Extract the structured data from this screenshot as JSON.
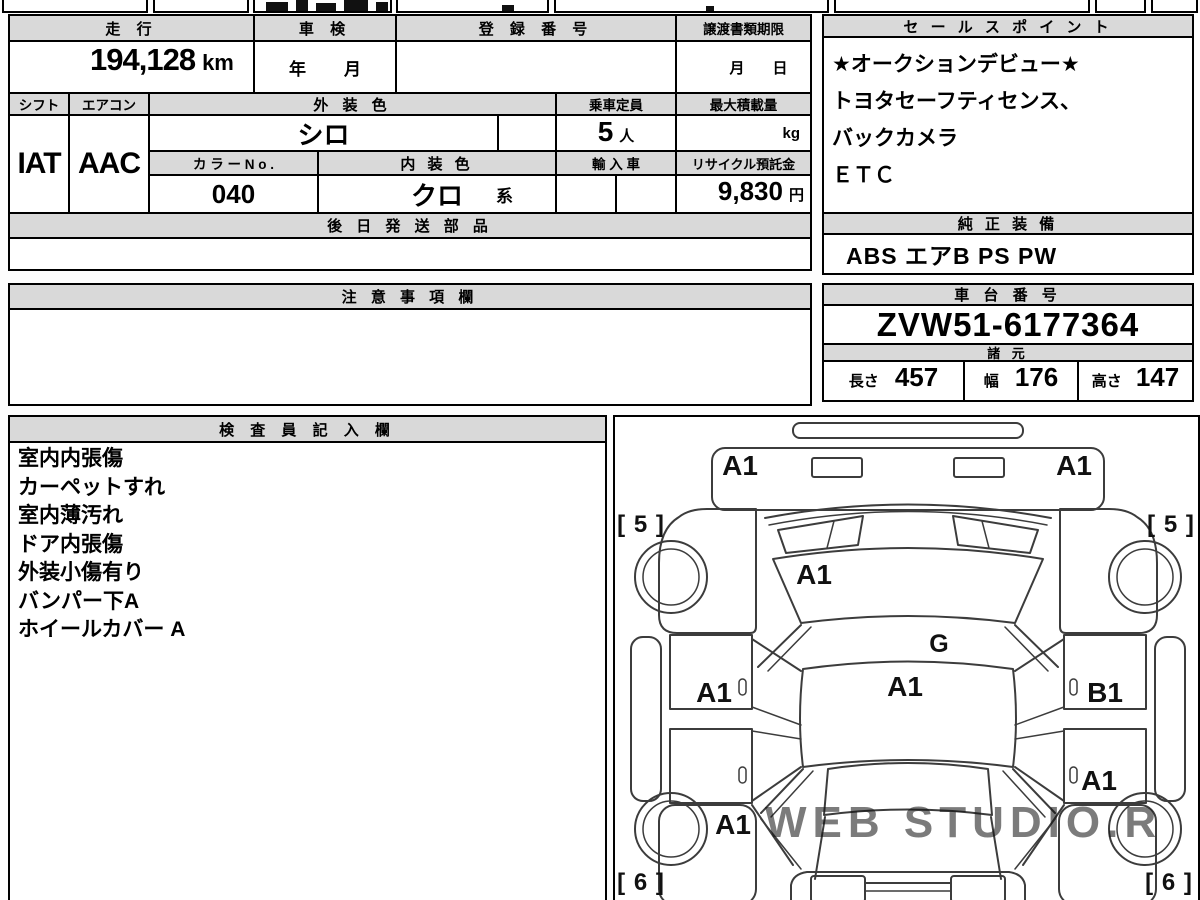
{
  "table": {
    "mileage_label": "走 行",
    "mileage_value": "194,128",
    "mileage_unit": "km",
    "shaken_label": "車 検",
    "shaken_year": "年",
    "shaken_month": "月",
    "registration_label": "登 録 番 号",
    "registration_value": "",
    "transfer_label": "譲渡書類期限",
    "transfer_month": "月",
    "transfer_day": "日",
    "shift_label": "シフト",
    "shift_value": "IAT",
    "aircon_label": "エアコン",
    "aircon_value": "AAC",
    "exterior_color_label": "外 装 色",
    "exterior_color_value": "シロ",
    "capacity_label": "乗車定員",
    "capacity_value": "5",
    "capacity_unit": "人",
    "max_load_label": "最大積載量",
    "max_load_unit": "kg",
    "color_no_label": "カ ラ ー N o .",
    "color_no_value": "040",
    "interior_color_label": "内 装 色",
    "interior_color_value": "クロ",
    "interior_color_suffix": "系",
    "import_label": "輸 入 車",
    "recycle_label": "リサイクル預託金",
    "recycle_value": "9,830",
    "recycle_unit": "円",
    "later_shipping_label": "後 日 発 送 部 品",
    "later_shipping_value": "",
    "notes_label": "注 意 事 項 欄",
    "notes_value": ""
  },
  "sales_points": {
    "title": "セ ー ル ス ポ イ ン ト",
    "lines": [
      "★オークションデビュー★",
      "トヨタセーフティセンス、",
      "バックカメラ",
      "ＥＴＣ"
    ]
  },
  "equipment": {
    "title": "純 正 装 備",
    "value": "ABS エアB PS PW"
  },
  "chassis": {
    "title": "車 台 番 号",
    "number": "ZVW51-6177364"
  },
  "specs": {
    "title": "諸 元",
    "length_label": "長さ",
    "length_value": "457",
    "width_label": "幅",
    "width_value": "176",
    "height_label": "高さ",
    "height_value": "147"
  },
  "inspector": {
    "title": "検 査 員 記 入 欄",
    "lines": [
      "室内内張傷",
      "カーペットすれ",
      "室内薄汚れ",
      "ドア内張傷",
      "外装小傷有り",
      "バンパー下A",
      "ホイールカバー A"
    ]
  },
  "diagram": {
    "watermark": "WEB STUDIO.R",
    "labels": [
      {
        "part": "front-bumper-left",
        "text": "A1"
      },
      {
        "part": "front-bumper-right",
        "text": "A1"
      },
      {
        "part": "front-left-tire",
        "text": "[ 5 ]"
      },
      {
        "part": "front-right-tire",
        "text": "[ 5 ]"
      },
      {
        "part": "hood",
        "text": "A1"
      },
      {
        "part": "windshield",
        "text": "G"
      },
      {
        "part": "roof",
        "text": "A1"
      },
      {
        "part": "front-left-door",
        "text": "A1"
      },
      {
        "part": "front-right-door",
        "text": "B1"
      },
      {
        "part": "rear-right-door",
        "text": "A1"
      },
      {
        "part": "rear-left-quarter",
        "text": "A1"
      },
      {
        "part": "rear-left-tire",
        "text": "[ 6 ]"
      },
      {
        "part": "rear-right-tire",
        "text": "[ 6 ]"
      }
    ]
  }
}
